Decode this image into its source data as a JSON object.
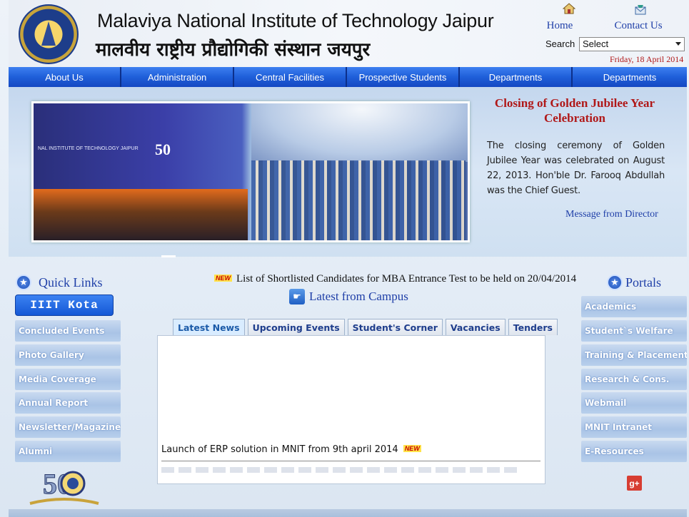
{
  "header": {
    "title_en": "Malaviya National Institute of Technology Jaipur",
    "title_hi": "मालवीय राष्ट्रीय प्रौद्योगिकी संस्थान जयपुर",
    "home_label": "Home",
    "contact_label": "Contact Us",
    "search_label": "Search",
    "search_selected": "Select",
    "date": "Friday, 18 April 2014"
  },
  "nav": {
    "items": [
      {
        "label": "About Us"
      },
      {
        "label": "Administration"
      },
      {
        "label": "Central Facilities"
      },
      {
        "label": "Prospective Students"
      },
      {
        "label": "Departments"
      },
      {
        "label": "Departments"
      }
    ]
  },
  "banner": {
    "story_title": "Closing of Golden Jubilee Year Celebration",
    "story_body": "The closing ceremony of Golden Jubilee Year was celebrated on August 22, 2013. Hon'ble Dr. Farooq Abdullah was the Chief Guest.",
    "director_link": "Message from Director",
    "photo_banner_text": "NAL INSTITUTE OF TECHNOLOGY JAIPUR",
    "photo_logo_text": "50"
  },
  "quick_links": {
    "heading": "Quick Links",
    "featured": "IIIT Kota",
    "items": [
      {
        "label": "Concluded Events"
      },
      {
        "label": "Photo Gallery"
      },
      {
        "label": "Media Coverage"
      },
      {
        "label": "Annual Report"
      },
      {
        "label": "Newsletter/Magazine"
      },
      {
        "label": "Alumni"
      }
    ]
  },
  "center": {
    "new_badge": "NEW",
    "ticker": "List of Shortlisted Candidates for MBA Entrance Test to be held on 20/04/2014",
    "campus_heading": "Latest from Campus",
    "tabs": [
      {
        "label": "Latest News"
      },
      {
        "label": "Upcoming Events"
      },
      {
        "label": "Student's Corner"
      },
      {
        "label": "Vacancies"
      },
      {
        "label": "Tenders"
      }
    ],
    "news_item": "Launch of ERP solution in MNIT from 9th april 2014"
  },
  "portals": {
    "heading": "Portals",
    "items": [
      {
        "label": "Academics"
      },
      {
        "label": "Student`s Welfare"
      },
      {
        "label": "Training & Placement"
      },
      {
        "label": "Research & Cons."
      },
      {
        "label": "Webmail"
      },
      {
        "label": "MNIT Intranet"
      },
      {
        "label": "E-Resources"
      }
    ]
  },
  "footer": {
    "gplus_label": "g+",
    "jubilee_number": "50"
  },
  "colors": {
    "nav_blue": "#1f5fd9",
    "link_blue": "#1f3fa8",
    "headline_red": "#b01818"
  }
}
